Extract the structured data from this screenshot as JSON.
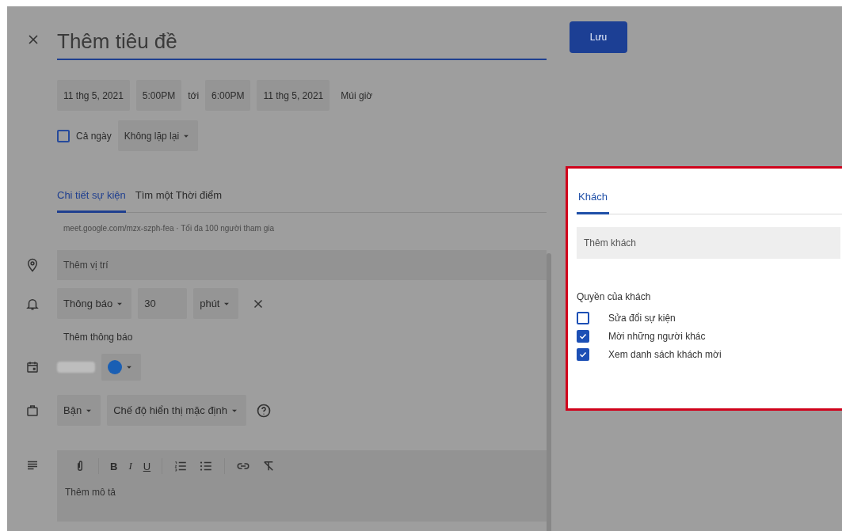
{
  "title_field": {
    "placeholder": "Thêm tiêu đề"
  },
  "save_button": "Lưu",
  "datetime": {
    "start_date": "11 thg 5, 2021",
    "start_time": "5:00PM",
    "separator": "tới",
    "end_time": "6:00PM",
    "end_date": "11 thg 5, 2021",
    "timezone": "Múi giờ"
  },
  "all_day": {
    "label": "Cả ngày",
    "checked": false
  },
  "repeat": "Không lặp lại",
  "tabs": [
    {
      "label": "Chi tiết sự kiện",
      "selected": true
    },
    {
      "label": "Tìm một Thời điểm",
      "selected": false
    }
  ],
  "meet_info": "meet.google.com/mzx-szph-fea · Tối đa 100 người tham gia",
  "location": {
    "placeholder": "Thêm vị trí"
  },
  "notification": {
    "type": "Thông báo",
    "value": "30",
    "unit": "phút"
  },
  "add_notification": "Thêm thông báo",
  "availability": "Bận",
  "visibility": "Chế độ hiển thị mặc định",
  "format_buttons": [
    "B",
    "I",
    "U"
  ],
  "description": {
    "placeholder": "Thêm mô tả"
  },
  "guests": {
    "tabs": [
      {
        "label": "Khách",
        "selected": true
      }
    ],
    "field": {
      "placeholder": "Thêm khách"
    },
    "permissions_title": "Quyền của khách",
    "permissions": [
      {
        "label": "Sửa đổi sự kiện",
        "checked": false
      },
      {
        "label": "Mời những người khác",
        "checked": true
      },
      {
        "label": "Xem danh sách khách mời",
        "checked": true
      }
    ]
  }
}
